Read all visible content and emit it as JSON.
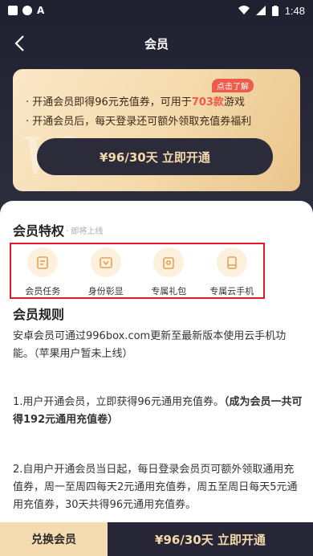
{
  "status_bar": {
    "time": "1:48",
    "a_label": "A"
  },
  "nav": {
    "title": "会员"
  },
  "card": {
    "tag": "点击了解",
    "line1_prefix": "· 开通会员即得96元充值券，可用于",
    "line1_highlight": "703款",
    "line1_suffix": "游戏",
    "line2": "· 开通会员后，每天登录还可额外领取充值券福利",
    "button": "¥96/30天 立即开通"
  },
  "privileges": {
    "title": "会员特权",
    "subtitle": "· 即将上线",
    "items": [
      {
        "label": "会员任务",
        "icon": "task-icon"
      },
      {
        "label": "身份彰显",
        "icon": "badge-icon"
      },
      {
        "label": "专属礼包",
        "icon": "gift-icon"
      },
      {
        "label": "专属云手机",
        "icon": "cloud-phone-icon"
      }
    ]
  },
  "rules": {
    "title": "会员规则",
    "p1": "安卓会员可通过996box.com更新至最新版本使用云手机功能。（苹果用户暂未上线）",
    "p2_normal": "1.用户开通会员，立即获得96元通用充值券。",
    "p2_bold": "（成为会员一共可得192元通用充值卷）",
    "p3": "2.自用户开通会员当日起，每日登录会员页可额外领取通用充值券，周一至周四每天2元通用充值券，周五至周日每天5元通用充值券，30天共得96元通用充值券。"
  },
  "bottom": {
    "exchange": "兑换会员",
    "open": "¥96/30天 立即开通"
  },
  "colors": {
    "gold": "#f4d9ab",
    "dark": "#262636",
    "highlight": "#f05a4a",
    "selection_border": "#e01b24"
  }
}
